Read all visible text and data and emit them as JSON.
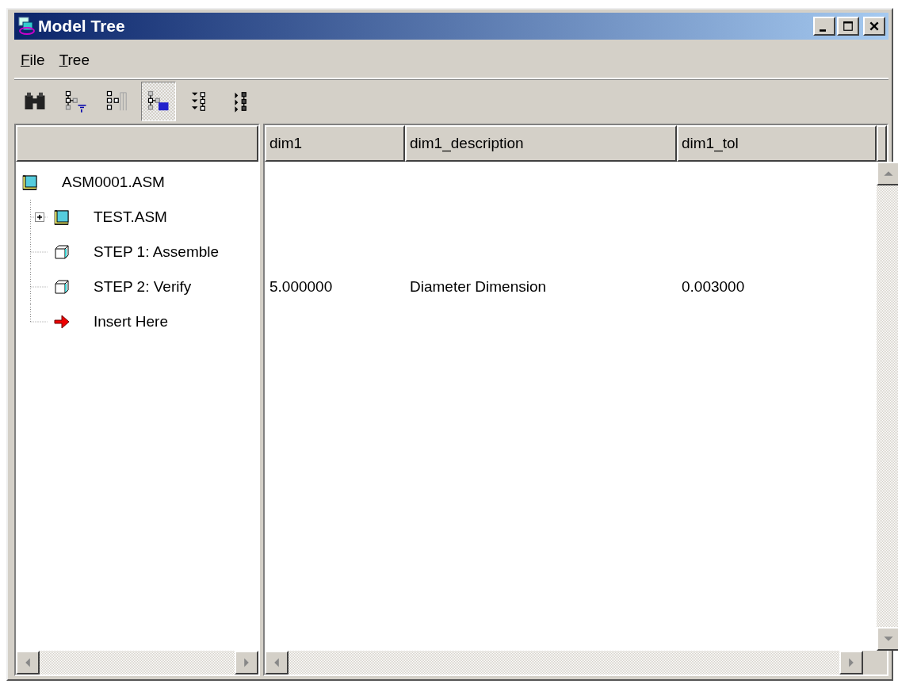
{
  "window": {
    "title": "Model Tree"
  },
  "menu": [
    {
      "label": "File"
    },
    {
      "label": "Tree"
    }
  ],
  "toolbar": [
    {
      "kind": "find",
      "selected": false
    },
    {
      "kind": "filter",
      "selected": false
    },
    {
      "kind": "columns",
      "selected": false
    },
    {
      "kind": "tree-view",
      "selected": true
    },
    {
      "kind": "expand",
      "selected": false
    },
    {
      "kind": "collapse",
      "selected": false
    }
  ],
  "table": {
    "columns": [
      "dim1",
      "dim1_description",
      "dim1_tol"
    ]
  },
  "tree": [
    {
      "label": "ASM0001.ASM",
      "kind": "assembly",
      "children": [
        {
          "label": "TEST.ASM",
          "kind": "assembly",
          "expanded": false
        },
        {
          "label": "STEP 1: Assemble",
          "kind": "part"
        },
        {
          "label": "STEP 2: Verify",
          "kind": "part",
          "cells": [
            "5.000000",
            "Diameter Dimension",
            "0.003000"
          ]
        },
        {
          "label": "Insert Here",
          "kind": "insert"
        }
      ]
    }
  ]
}
